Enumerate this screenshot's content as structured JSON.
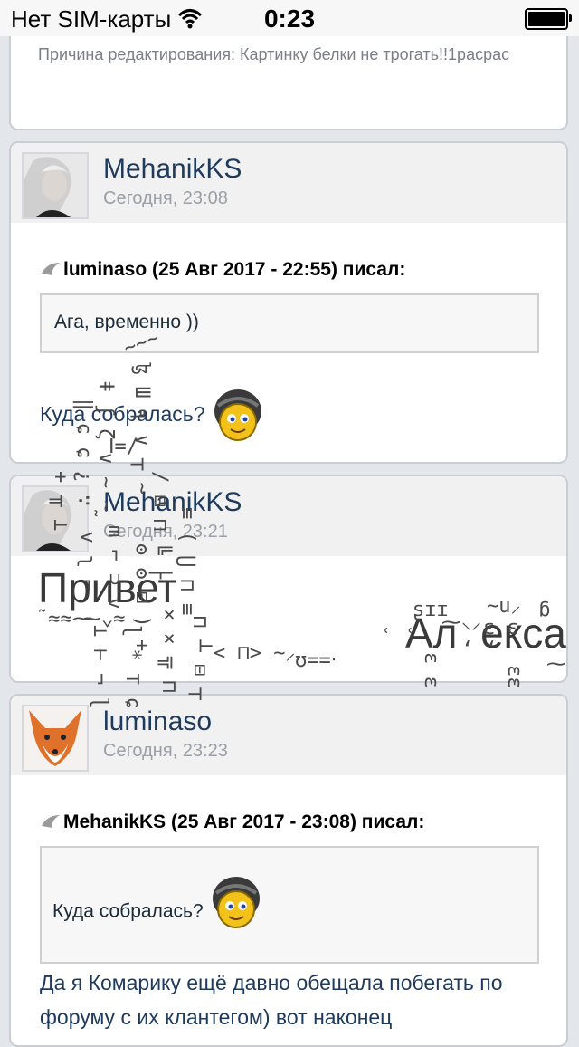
{
  "status": {
    "carrier": "Нет SIM-карты",
    "time": "0:23"
  },
  "edit_note": {
    "text": "Причина редактирования: Картинку белки не трогать!!1расрас"
  },
  "posts": [
    {
      "author": "MehanikKS",
      "date": "Сегодня, 23:08",
      "quote_header": "luminaso (25 Авг 2017 - 22:55) писал:",
      "quote_text": "Ага, временно ))",
      "body": "Куда собралась?"
    },
    {
      "author": "MehanikKS",
      "date": "Сегодня, 23:21",
      "body_left": "Привет",
      "body_right": "Ал  екса"
    },
    {
      "author": "luminaso",
      "date": "Сегодня, 23:23",
      "quote_header": "MehanikKS (25 Авг 2017 - 23:08) писал:",
      "quote_text": "Куда собралась?",
      "body": "Да я Комарику ещё давно обещала побегать по форуму с их клантегом) вот наконец"
    }
  ],
  "icons": {
    "wifi": "wifi-icon",
    "battery": "battery-icon",
    "quote": "quote-icon",
    "smiley": "smiley-helmet-icon",
    "avatar_female": "avatar-photo",
    "avatar_fox": "avatar-fox"
  },
  "colors": {
    "author": "#1e3a5c",
    "header_bg": "#f1f1f1",
    "page_bg": "#e3e6ea"
  }
}
